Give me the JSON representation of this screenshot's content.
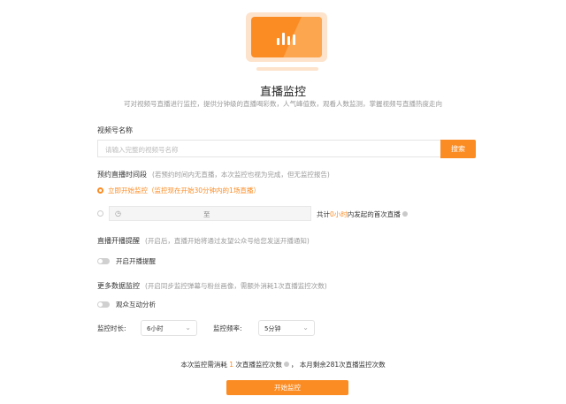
{
  "header": {
    "title": "直播监控",
    "subtitle": "可对视频号直播进行监控，提供分钟级的直播喝彩数，人气峰值数，观看人数监测，掌握视频号直播热度走向"
  },
  "channel": {
    "label": "视频号名称",
    "placeholder": "请输入完整的视频号名称",
    "search_label": "搜索"
  },
  "schedule": {
    "label": "预约直播时间段",
    "hint": "(若预约时间内无直播，本次监控也视为完成，但无监控报告)",
    "option_now": "立即开始监控（监控现在开始30分钟内的1场直播）",
    "range_separator": "至",
    "summary_prefix": "共计",
    "summary_value": "0小时",
    "summary_suffix": "内发起的首次直播"
  },
  "reminder": {
    "label": "直播开播提醒",
    "hint": "(开启后，直播开始将通过友望公众号给您发送开播通知)",
    "toggle_label": "开启开播提醒",
    "enabled": false
  },
  "more_data": {
    "label": "更多数据监控",
    "hint": "(开启同步监控弹幕与粉丝画像，需额外消耗1次直播监控次数)",
    "toggle_label": "观众互动分析",
    "enabled": false
  },
  "duration": {
    "label": "监控时长:",
    "value": "6小时"
  },
  "frequency": {
    "label": "监控频率:",
    "value": "5分钟"
  },
  "usage": {
    "cost_prefix": "本次监控需消耗",
    "cost_value": "1",
    "cost_suffix": "次直播监控次数",
    "remaining": "本月剩余281次直播监控次数"
  },
  "start_label": "开始监控",
  "colors": {
    "accent": "#fb8c24",
    "accent_light": "#fde3cc"
  }
}
